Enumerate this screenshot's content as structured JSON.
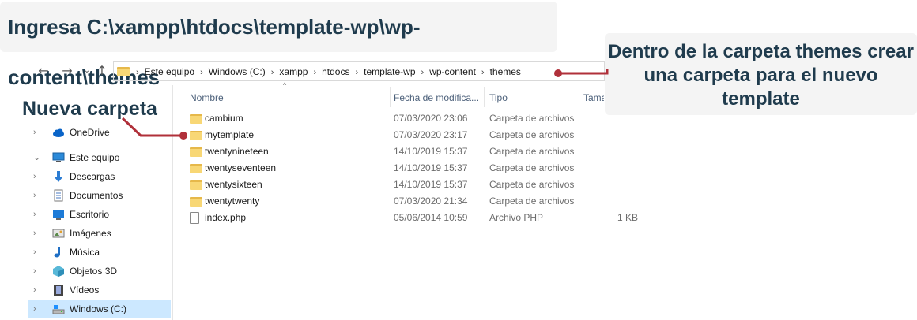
{
  "callouts": {
    "top": "Ingresa C:\\xampp\\htdocs\\template-wp\\wp-content\\themes",
    "right": "Dentro de la carpeta themes crear una carpeta para el nuevo template",
    "left": "Nueva carpeta"
  },
  "nav": {
    "back_icon": "arrow-left-icon",
    "forward_icon": "arrow-right-icon",
    "history_icon": "chevron-down-icon",
    "up_icon": "arrow-up-icon",
    "back": "←",
    "forward": "→",
    "history": "⌄",
    "up": "↑"
  },
  "breadcrumb": [
    "Este equipo",
    "Windows (C:)",
    "xampp",
    "htdocs",
    "template-wp",
    "wp-content",
    "themes"
  ],
  "breadcrumb_sep": "›",
  "columns": {
    "name": "Nombre",
    "date": "Fecha de modifica...",
    "type": "Tipo",
    "size": "Tama"
  },
  "sort_arrow": "^",
  "sidebar": {
    "items": [
      {
        "label": "OneDrive",
        "icon": "cloud-icon",
        "chevron": "›"
      },
      {
        "label": "Este equipo",
        "icon": "computer-icon",
        "chevron": "⌄"
      },
      {
        "label": "Descargas",
        "icon": "download-icon",
        "chevron": "›"
      },
      {
        "label": "Documentos",
        "icon": "document-icon",
        "chevron": "›"
      },
      {
        "label": "Escritorio",
        "icon": "desktop-icon",
        "chevron": "›"
      },
      {
        "label": "Imágenes",
        "icon": "image-icon",
        "chevron": "›"
      },
      {
        "label": "Música",
        "icon": "music-icon",
        "chevron": "›"
      },
      {
        "label": "Objetos 3D",
        "icon": "cube-icon",
        "chevron": "›"
      },
      {
        "label": "Vídeos",
        "icon": "video-icon",
        "chevron": "›"
      },
      {
        "label": "Windows (C:)",
        "icon": "drive-icon",
        "chevron": "›"
      }
    ]
  },
  "files": [
    {
      "name": "cambium",
      "date": "07/03/2020 23:06",
      "type": "Carpeta de archivos",
      "size": "",
      "icon": "folder-icon"
    },
    {
      "name": "mytemplate",
      "date": "07/03/2020 23:17",
      "type": "Carpeta de archivos",
      "size": "",
      "icon": "folder-icon"
    },
    {
      "name": "twentynineteen",
      "date": "14/10/2019 15:37",
      "type": "Carpeta de archivos",
      "size": "",
      "icon": "folder-icon"
    },
    {
      "name": "twentyseventeen",
      "date": "14/10/2019 15:37",
      "type": "Carpeta de archivos",
      "size": "",
      "icon": "folder-icon"
    },
    {
      "name": "twentysixteen",
      "date": "14/10/2019 15:37",
      "type": "Carpeta de archivos",
      "size": "",
      "icon": "folder-icon"
    },
    {
      "name": "twentytwenty",
      "date": "07/03/2020 21:34",
      "type": "Carpeta de archivos",
      "size": "",
      "icon": "folder-icon"
    },
    {
      "name": "index.php",
      "date": "05/06/2014 10:59",
      "type": "Archivo PHP",
      "size": "1 KB",
      "icon": "file-icon"
    }
  ],
  "colors": {
    "callout_text": "#1f3b4d",
    "connector": "#b0303a",
    "folder": "#f8d775",
    "selected": "#cce8ff"
  }
}
